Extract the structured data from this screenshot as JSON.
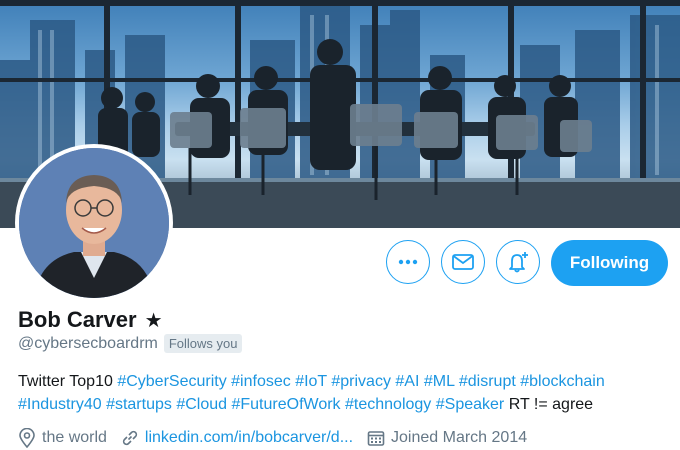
{
  "profile": {
    "name": "Bob Carver",
    "badge_glyph": "★",
    "handle": "@cybersecboardrm",
    "follows_you": "Follows you",
    "bio_segments": [
      {
        "text": "Twitter Top10 ",
        "tag": false
      },
      {
        "text": "#CyberSecurity",
        "tag": true
      },
      {
        "text": " ",
        "tag": false
      },
      {
        "text": "#infosec",
        "tag": true
      },
      {
        "text": " ",
        "tag": false
      },
      {
        "text": "#IoT",
        "tag": true
      },
      {
        "text": " ",
        "tag": false
      },
      {
        "text": "#privacy",
        "tag": true
      },
      {
        "text": " ",
        "tag": false
      },
      {
        "text": "#AI",
        "tag": true
      },
      {
        "text": " ",
        "tag": false
      },
      {
        "text": "#ML",
        "tag": true
      },
      {
        "text": " ",
        "tag": false
      },
      {
        "text": "#disrupt",
        "tag": true
      },
      {
        "text": " ",
        "tag": false
      },
      {
        "text": "#blockchain",
        "tag": true
      },
      {
        "text": " ",
        "tag": false
      },
      {
        "text": "#Industry40",
        "tag": true
      },
      {
        "text": " ",
        "tag": false
      },
      {
        "text": "#startups",
        "tag": true
      },
      {
        "text": " ",
        "tag": false
      },
      {
        "text": "#Cloud",
        "tag": true
      },
      {
        "text": " ",
        "tag": false
      },
      {
        "text": "#FutureOfWork",
        "tag": true
      },
      {
        "text": " ",
        "tag": false
      },
      {
        "text": "#technology",
        "tag": true
      },
      {
        "text": " ",
        "tag": false
      },
      {
        "text": "#Speaker",
        "tag": true
      },
      {
        "text": " RT != agree",
        "tag": false
      }
    ],
    "location": "the world",
    "website": "linkedin.com/in/bobcarver/d...",
    "joined": "Joined March 2014"
  },
  "actions": {
    "more_icon": "more-dots-icon",
    "message_icon": "envelope-icon",
    "notify_icon": "bell-plus-icon",
    "following_label": "Following"
  },
  "icons": {
    "location": "map-pin-icon",
    "website": "link-icon",
    "joined": "calendar-icon"
  },
  "colors": {
    "accent": "#1da1f2",
    "link": "#1b95e0",
    "muted": "#657786",
    "text": "#14171a"
  }
}
